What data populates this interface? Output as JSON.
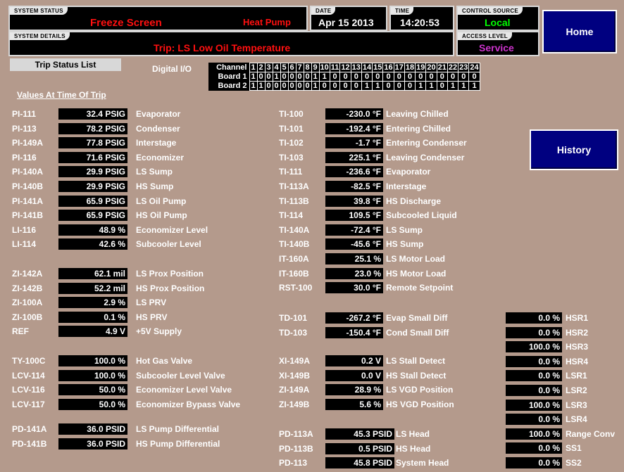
{
  "header": {
    "system_status_label": "SYSTEM STATUS",
    "system_status_value": "Freeze Screen",
    "system_mode": "Heat Pump",
    "system_details_label": "SYSTEM DETAILS",
    "system_details_value": "Trip: LS Low Oil Temperature",
    "date_label": "DATE",
    "date_value": "Apr 15 2013",
    "time_label": "TIME",
    "time_value": "14:20:53",
    "control_source_label": "CONTROL SOURCE",
    "control_source_value": "Local",
    "access_level_label": "ACCESS LEVEL",
    "access_level_value": "Service",
    "home_button": "Home",
    "history_button": "History"
  },
  "trip_status_button": "Trip Status List",
  "values_heading": "Values At Time Of Trip",
  "digital_io": {
    "label": "Digital I/O",
    "channel_label": "Channel",
    "channels": [
      "1",
      "2",
      "3",
      "4",
      "5",
      "6",
      "7",
      "8",
      "9",
      "10",
      "11",
      "12",
      "13",
      "14",
      "15",
      "16",
      "17",
      "18",
      "19",
      "20",
      "21",
      "22",
      "23",
      "24"
    ],
    "board1_label": "Board 1",
    "board1": [
      "1",
      "0",
      "0",
      "1",
      "0",
      "0",
      "0",
      "0",
      "1",
      "1",
      "0",
      "0",
      "0",
      "0",
      "0",
      "0",
      "0",
      "0",
      "0",
      "0",
      "0",
      "0",
      "0",
      "0"
    ],
    "board2_label": "Board 2",
    "board2": [
      "1",
      "1",
      "0",
      "0",
      "0",
      "0",
      "0",
      "0",
      "1",
      "0",
      "0",
      "0",
      "0",
      "1",
      "1",
      "0",
      "0",
      "0",
      "1",
      "1",
      "0",
      "1",
      "1",
      "1"
    ]
  },
  "col1": [
    {
      "tag": "PI-111",
      "value": "32.4 PSIG",
      "desc": "Evaporator"
    },
    {
      "tag": "PI-113",
      "value": "78.2 PSIG",
      "desc": "Condenser"
    },
    {
      "tag": "PI-149A",
      "value": "77.8 PSIG",
      "desc": "Interstage"
    },
    {
      "tag": "PI-116",
      "value": "71.6 PSIG",
      "desc": "Economizer"
    },
    {
      "tag": "PI-140A",
      "value": "29.9 PSIG",
      "desc": "LS Sump"
    },
    {
      "tag": "PI-140B",
      "value": "29.9 PSIG",
      "desc": "HS Sump"
    },
    {
      "tag": "PI-141A",
      "value": "65.9 PSIG",
      "desc": "LS Oil Pump"
    },
    {
      "tag": "PI-141B",
      "value": "65.9 PSIG",
      "desc": "HS Oil Pump"
    },
    {
      "tag": "LI-116",
      "value": "48.9 %",
      "desc": "Economizer Level"
    },
    {
      "tag": "LI-114",
      "value": "42.6 %",
      "desc": "Subcooler Level"
    }
  ],
  "col1b": [
    {
      "tag": "ZI-142A",
      "value": "62.1  mil",
      "desc": "LS Prox Position"
    },
    {
      "tag": "ZI-142B",
      "value": "52.2  mil",
      "desc": "HS Prox Position"
    },
    {
      "tag": "ZI-100A",
      "value": "2.9 %",
      "desc": "LS PRV"
    },
    {
      "tag": "ZI-100B",
      "value": "0.1 %",
      "desc": "HS PRV"
    },
    {
      "tag": "REF",
      "value": "4.9 V",
      "desc": "+5V Supply"
    }
  ],
  "col1c": [
    {
      "tag": "TY-100C",
      "value": "100.0 %",
      "desc": "Hot Gas Valve"
    },
    {
      "tag": "LCV-114",
      "value": "100.0 %",
      "desc": "Subcooler Level Valve"
    },
    {
      "tag": "LCV-116",
      "value": "50.0 %",
      "desc": "Economizer Level Valve"
    },
    {
      "tag": "LCV-117",
      "value": "50.0 %",
      "desc": "Economizer Bypass Valve"
    }
  ],
  "col1d": [
    {
      "tag": "PD-141A",
      "value": "36.0 PSID",
      "desc": "LS Pump Differential"
    },
    {
      "tag": "PD-141B",
      "value": "36.0 PSID",
      "desc": "HS Pump Differential"
    }
  ],
  "col2": [
    {
      "tag": "TI-100",
      "value": "-230.0 °F",
      "desc": "Leaving Chilled"
    },
    {
      "tag": "TI-101",
      "value": "-192.4 °F",
      "desc": "Entering Chilled"
    },
    {
      "tag": "TI-102",
      "value": "-1.7 °F",
      "desc": "Entering Condenser"
    },
    {
      "tag": "TI-103",
      "value": "225.1 °F",
      "desc": "Leaving Condenser"
    },
    {
      "tag": "TI-111",
      "value": "-236.6 °F",
      "desc": "Evaporator"
    },
    {
      "tag": "TI-113A",
      "value": "-82.5 °F",
      "desc": "Interstage"
    },
    {
      "tag": "TI-113B",
      "value": "39.8 °F",
      "desc": "HS Discharge"
    },
    {
      "tag": "TI-114",
      "value": "109.5 °F",
      "desc": "Subcooled Liquid"
    },
    {
      "tag": "TI-140A",
      "value": "-72.4 °F",
      "desc": "LS Sump"
    },
    {
      "tag": "TI-140B",
      "value": "-45.6 °F",
      "desc": "HS Sump"
    },
    {
      "tag": "IT-160A",
      "value": "25.1 %",
      "desc": "LS Motor Load"
    },
    {
      "tag": "IT-160B",
      "value": "23.0 %",
      "desc": "HS Motor Load"
    },
    {
      "tag": "RST-100",
      "value": "30.0 °F",
      "desc": "Remote Setpoint"
    }
  ],
  "col2b": [
    {
      "tag": "TD-101",
      "value": "-267.2 °F",
      "desc": "Evap Small Diff"
    },
    {
      "tag": "TD-103",
      "value": "-150.4 °F",
      "desc": "Cond Small Diff"
    }
  ],
  "col2c": [
    {
      "tag": "XI-149A",
      "value": "0.2 V",
      "desc": "LS Stall Detect"
    },
    {
      "tag": "XI-149B",
      "value": "0.0 V",
      "desc": "HS Stall Detect"
    },
    {
      "tag": "ZI-149A",
      "value": "28.9 %",
      "desc": "LS VGD Position"
    },
    {
      "tag": "ZI-149B",
      "value": "5.6 %",
      "desc": "HS VGD Position"
    }
  ],
  "col2d": [
    {
      "tag": "PD-113A",
      "value": "45.3 PSID",
      "desc": "LS Head"
    },
    {
      "tag": "PD-113B",
      "value": "0.5 PSID",
      "desc": "HS Head"
    },
    {
      "tag": "PD-113",
      "value": "45.8 PSID",
      "desc": "System Head"
    }
  ],
  "col3": [
    {
      "value": "0.0 %",
      "desc": "HSR1"
    },
    {
      "value": "0.0 %",
      "desc": "HSR2"
    },
    {
      "value": "100.0 %",
      "desc": "HSR3"
    },
    {
      "value": "0.0 %",
      "desc": "HSR4"
    },
    {
      "value": "0.0 %",
      "desc": "LSR1"
    },
    {
      "value": "0.0 %",
      "desc": "LSR2"
    },
    {
      "value": "100.0 %",
      "desc": "LSR3"
    },
    {
      "value": "0.0 %",
      "desc": "LSR4"
    },
    {
      "value": "100.0 %",
      "desc": "Range Conv"
    },
    {
      "value": "0.0 %",
      "desc": "SS1"
    },
    {
      "value": "0.0 %",
      "desc": "SS2"
    }
  ]
}
